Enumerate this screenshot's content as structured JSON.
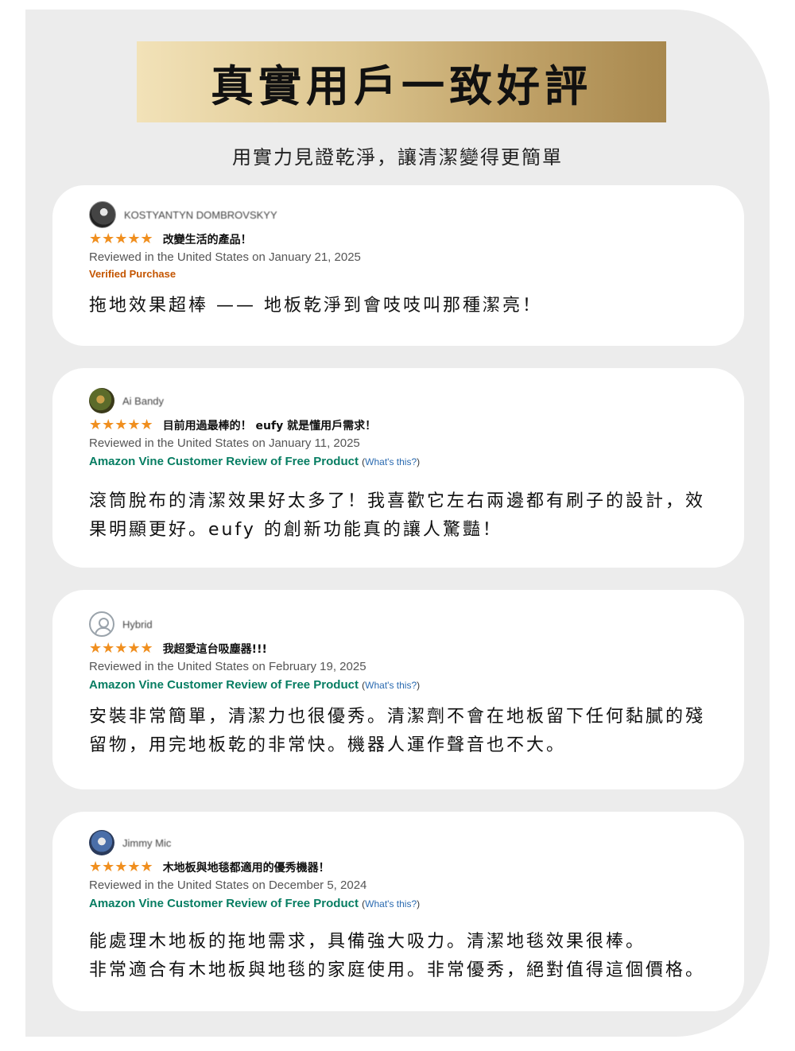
{
  "header": {
    "title": "真實用戶一致好評",
    "subtitle": "用實力見證乾淨，讓清潔變得更簡單"
  },
  "reviews": [
    {
      "name": "KOSTYANTYN DOMBROVSKYY",
      "stars": "★★★★★",
      "rating": 5,
      "title": "改變生活的產品！",
      "meta": "Reviewed in the United States on January 21, 2025",
      "badge": "Verified Purchase",
      "body": "拖地效果超棒 —— 地板乾淨到會吱吱叫那種潔亮！"
    },
    {
      "name": "Ai Bandy",
      "stars": "★★★★★",
      "rating": 5,
      "title": "目前用過最棒的！ eufy 就是懂用戶需求！",
      "meta": "Reviewed in the United States on January 11, 2025",
      "badge": "Amazon Vine Customer Review of Free Product",
      "whats": "What's this?",
      "body": "滾筒脫布的清潔效果好太多了！我喜歡它左右兩邊都有刷子的設計，效果明顯更好。eufy 的創新功能真的讓人驚豔！"
    },
    {
      "name": "Hybrid",
      "stars": "★★★★★",
      "rating": 5,
      "title": "我超愛這台吸塵器!!!",
      "meta": "Reviewed in the United States on February 19, 2025",
      "badge": "Amazon Vine Customer Review of Free Product",
      "whats": "What's this?",
      "body": "安裝非常簡單，清潔力也很優秀。清潔劑不會在地板留下任何黏膩的殘留物，用完地板乾的非常快。機器人運作聲音也不大。"
    },
    {
      "name": "Jimmy Mic",
      "stars": "★★★★★",
      "rating": 5,
      "title": "木地板與地毯都適用的優秀機器！",
      "meta": "Reviewed in the United States on December 5, 2024",
      "badge": "Amazon Vine Customer Review of Free Product",
      "whats": "What's this?",
      "body_line1": "能處理木地板的拖地需求，具備強大吸力。清潔地毯效果很棒。",
      "body_line2": "非常適合有木地板與地毯的家庭使用。非常優秀，絕對值得這個價格。"
    }
  ],
  "colors": {
    "star": "#f08f1f",
    "verified": "#c45500",
    "vine": "#067d62",
    "link": "#2a6ab0",
    "banner_light": "#f2e2b8",
    "banner_dark": "#a8884e",
    "panel_bg": "#ececec"
  }
}
